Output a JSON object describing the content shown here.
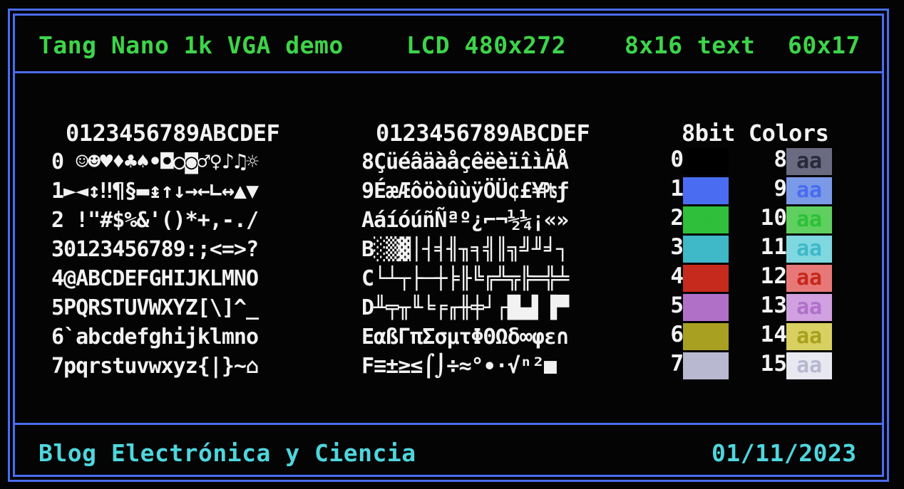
{
  "header": {
    "title": "Tang Nano 1k VGA demo",
    "lcd": "LCD 480x272",
    "font": "8x16 text",
    "grid": "60x17"
  },
  "charset": {
    "left_header": "0123456789ABCDEF",
    "right_header": "0123456789ABCDEF",
    "left_rows": [
      "0 ☺☻♥♦♣♠•◘○◙♂♀♪♫☼",
      "1►◄↕‼¶§▬↨↑↓→←∟↔▲▼",
      "2 !\"#$%&'()*+,-./",
      "30123456789:;<=>?",
      "4@ABCDEFGHIJKLMNO",
      "5PQRSTUVWXYZ[\\]^_",
      "6`abcdefghijklmno",
      "7pqrstuvwxyz{|}~⌂"
    ],
    "right_rows": [
      "8ÇüéâäàåçêëèïîìÄÅ",
      "9ÉæÆôöòûùÿÖÜ¢£¥₧ƒ",
      "AáíóúñÑªº¿⌐¬½¼¡«»",
      "B░▒▓│┤╡╢╖╕╣║╗╝╜╛┐",
      "C└┴┬├─┼╞╟╚╔╩╦╠═╬╧",
      "D╨╤╥╙╘╒╓╫╪┘┌█▄▌▐▀",
      "EαßΓπΣσµτΦΘΩδ∞φε∩",
      "F≡±≥≤⌠⌡÷≈°∙·√ⁿ²■ "
    ]
  },
  "colors": {
    "title": "8bit Colors",
    "sample_text": "aa",
    "entries": [
      {
        "index": "0",
        "bg": "#000000",
        "fg": "#000000"
      },
      {
        "index": "1",
        "bg": "#4a6cf0",
        "fg": "#4a6cf0"
      },
      {
        "index": "2",
        "bg": "#2fbf3a",
        "fg": "#2fbf3a"
      },
      {
        "index": "3",
        "bg": "#3fb8c8",
        "fg": "#3fb8c8"
      },
      {
        "index": "4",
        "bg": "#c62a1c",
        "fg": "#c62a1c"
      },
      {
        "index": "5",
        "bg": "#b070c8",
        "fg": "#b070c8"
      },
      {
        "index": "6",
        "bg": "#a8a020",
        "fg": "#a8a020"
      },
      {
        "index": "7",
        "bg": "#b8b8d0",
        "fg": "#b8b8d0"
      },
      {
        "index": "8",
        "bg": "#6a6a80",
        "fg": "#2a2a3a"
      },
      {
        "index": "9",
        "bg": "#7a9ae8",
        "fg": "#4a6cf0"
      },
      {
        "index": "10",
        "bg": "#5fd060",
        "fg": "#2fbf3a"
      },
      {
        "index": "11",
        "bg": "#7fd8e0",
        "fg": "#3fb8c8"
      },
      {
        "index": "12",
        "bg": "#e87878",
        "fg": "#c62a1c"
      },
      {
        "index": "13",
        "bg": "#d0a0e0",
        "fg": "#b070c8"
      },
      {
        "index": "14",
        "bg": "#d8d060",
        "fg": "#a8a020"
      },
      {
        "index": "15",
        "bg": "#e8e8f0",
        "fg": "#b8b8d0"
      }
    ]
  },
  "footer": {
    "blog": "Blog Electrónica y Ciencia",
    "date": "01/11/2023"
  }
}
